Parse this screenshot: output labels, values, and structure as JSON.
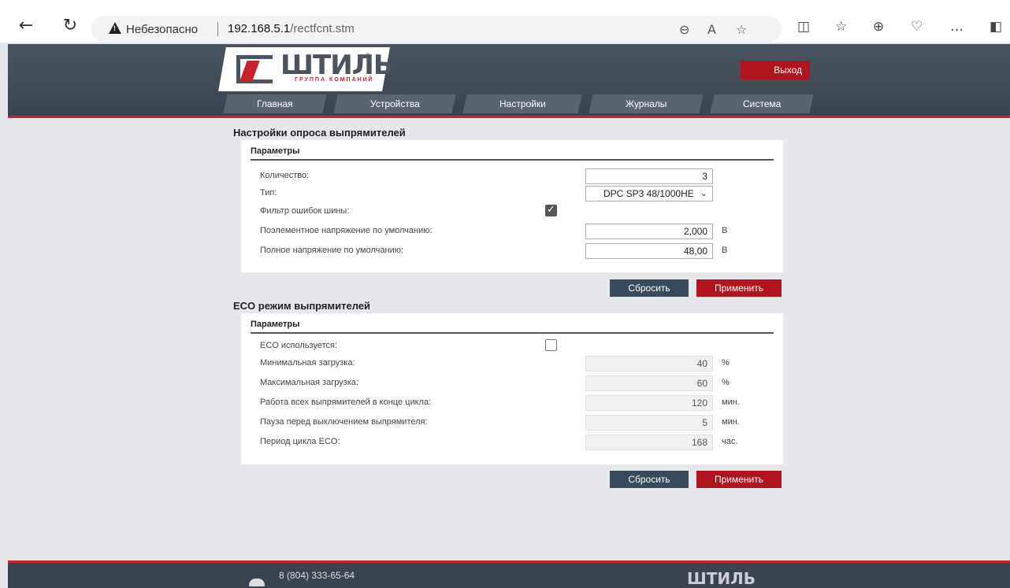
{
  "browser": {
    "insecure_label": "Небезопасно",
    "url_host": "192.168.5.1",
    "url_path": "/rectfcnt.stm"
  },
  "header": {
    "logo_text": "ШТИЛЬ",
    "logo_sub": "ГРУППА КОМПАНИЙ",
    "logo_reg": "®",
    "exit_label": "Выход",
    "menu": [
      "Главная",
      "Устройства",
      "Настройки",
      "Журналы",
      "Система"
    ]
  },
  "poll": {
    "title": "Настройки опроса выпрямителей",
    "panel_title": "Параметры",
    "count_label": "Количество:",
    "count_value": "3",
    "type_label": "Тип:",
    "type_value": "DPC SP3 48/1000HE",
    "filter_label": "Фильтр ошибок шины:",
    "filter_checked": true,
    "cell_voltage_label": "Поэлементное напряжение по умолчанию:",
    "cell_voltage_value": "2,000",
    "cell_voltage_unit": "В",
    "full_voltage_label": "Полное напряжение по умолчанию:",
    "full_voltage_value": "48,00",
    "full_voltage_unit": "В",
    "reset_label": "Сбросить",
    "apply_label": "Применить"
  },
  "eco": {
    "title": "ECO режим выпрямителей",
    "panel_title": "Параметры",
    "used_label": "ECO используется:",
    "used_checked": false,
    "rows": [
      {
        "label": "Минимальная загрузка:",
        "value": "40",
        "unit": "%"
      },
      {
        "label": "Максимальная загрузка:",
        "value": "60",
        "unit": "%"
      },
      {
        "label": "Работа всех выпрямителей в конце цикла:",
        "value": "120",
        "unit": "мин."
      },
      {
        "label": "Пауза перед выключением выпрямителя:",
        "value": "5",
        "unit": "мин."
      },
      {
        "label": "Период цикла ECO:",
        "value": "168",
        "unit": "час."
      }
    ],
    "reset_label": "Сбросить",
    "apply_label": "Применить"
  },
  "footer": {
    "phone": "8 (804) 333-65-64",
    "logo_text": "ШТИЛЬ"
  }
}
